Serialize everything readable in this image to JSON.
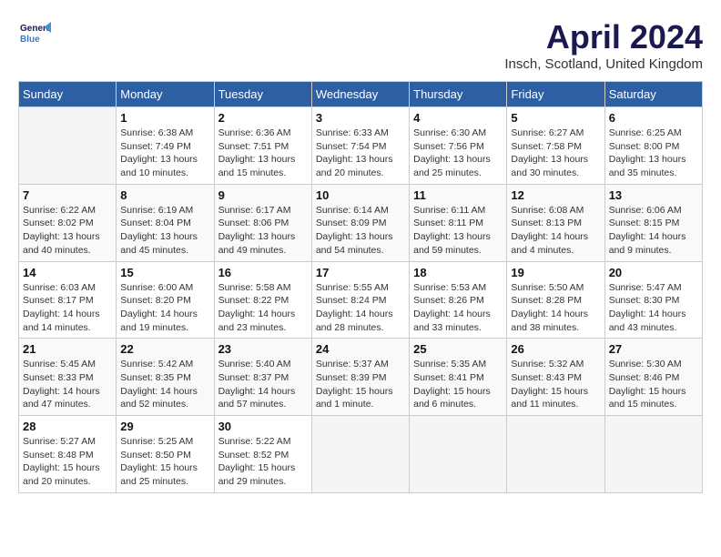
{
  "header": {
    "logo_line1": "General",
    "logo_line2": "Blue",
    "month_title": "April 2024",
    "location": "Insch, Scotland, United Kingdom"
  },
  "weekdays": [
    "Sunday",
    "Monday",
    "Tuesday",
    "Wednesday",
    "Thursday",
    "Friday",
    "Saturday"
  ],
  "weeks": [
    [
      {
        "day": "",
        "info": ""
      },
      {
        "day": "1",
        "info": "Sunrise: 6:38 AM\nSunset: 7:49 PM\nDaylight: 13 hours\nand 10 minutes."
      },
      {
        "day": "2",
        "info": "Sunrise: 6:36 AM\nSunset: 7:51 PM\nDaylight: 13 hours\nand 15 minutes."
      },
      {
        "day": "3",
        "info": "Sunrise: 6:33 AM\nSunset: 7:54 PM\nDaylight: 13 hours\nand 20 minutes."
      },
      {
        "day": "4",
        "info": "Sunrise: 6:30 AM\nSunset: 7:56 PM\nDaylight: 13 hours\nand 25 minutes."
      },
      {
        "day": "5",
        "info": "Sunrise: 6:27 AM\nSunset: 7:58 PM\nDaylight: 13 hours\nand 30 minutes."
      },
      {
        "day": "6",
        "info": "Sunrise: 6:25 AM\nSunset: 8:00 PM\nDaylight: 13 hours\nand 35 minutes."
      }
    ],
    [
      {
        "day": "7",
        "info": "Sunrise: 6:22 AM\nSunset: 8:02 PM\nDaylight: 13 hours\nand 40 minutes."
      },
      {
        "day": "8",
        "info": "Sunrise: 6:19 AM\nSunset: 8:04 PM\nDaylight: 13 hours\nand 45 minutes."
      },
      {
        "day": "9",
        "info": "Sunrise: 6:17 AM\nSunset: 8:06 PM\nDaylight: 13 hours\nand 49 minutes."
      },
      {
        "day": "10",
        "info": "Sunrise: 6:14 AM\nSunset: 8:09 PM\nDaylight: 13 hours\nand 54 minutes."
      },
      {
        "day": "11",
        "info": "Sunrise: 6:11 AM\nSunset: 8:11 PM\nDaylight: 13 hours\nand 59 minutes."
      },
      {
        "day": "12",
        "info": "Sunrise: 6:08 AM\nSunset: 8:13 PM\nDaylight: 14 hours\nand 4 minutes."
      },
      {
        "day": "13",
        "info": "Sunrise: 6:06 AM\nSunset: 8:15 PM\nDaylight: 14 hours\nand 9 minutes."
      }
    ],
    [
      {
        "day": "14",
        "info": "Sunrise: 6:03 AM\nSunset: 8:17 PM\nDaylight: 14 hours\nand 14 minutes."
      },
      {
        "day": "15",
        "info": "Sunrise: 6:00 AM\nSunset: 8:20 PM\nDaylight: 14 hours\nand 19 minutes."
      },
      {
        "day": "16",
        "info": "Sunrise: 5:58 AM\nSunset: 8:22 PM\nDaylight: 14 hours\nand 23 minutes."
      },
      {
        "day": "17",
        "info": "Sunrise: 5:55 AM\nSunset: 8:24 PM\nDaylight: 14 hours\nand 28 minutes."
      },
      {
        "day": "18",
        "info": "Sunrise: 5:53 AM\nSunset: 8:26 PM\nDaylight: 14 hours\nand 33 minutes."
      },
      {
        "day": "19",
        "info": "Sunrise: 5:50 AM\nSunset: 8:28 PM\nDaylight: 14 hours\nand 38 minutes."
      },
      {
        "day": "20",
        "info": "Sunrise: 5:47 AM\nSunset: 8:30 PM\nDaylight: 14 hours\nand 43 minutes."
      }
    ],
    [
      {
        "day": "21",
        "info": "Sunrise: 5:45 AM\nSunset: 8:33 PM\nDaylight: 14 hours\nand 47 minutes."
      },
      {
        "day": "22",
        "info": "Sunrise: 5:42 AM\nSunset: 8:35 PM\nDaylight: 14 hours\nand 52 minutes."
      },
      {
        "day": "23",
        "info": "Sunrise: 5:40 AM\nSunset: 8:37 PM\nDaylight: 14 hours\nand 57 minutes."
      },
      {
        "day": "24",
        "info": "Sunrise: 5:37 AM\nSunset: 8:39 PM\nDaylight: 15 hours\nand 1 minute."
      },
      {
        "day": "25",
        "info": "Sunrise: 5:35 AM\nSunset: 8:41 PM\nDaylight: 15 hours\nand 6 minutes."
      },
      {
        "day": "26",
        "info": "Sunrise: 5:32 AM\nSunset: 8:43 PM\nDaylight: 15 hours\nand 11 minutes."
      },
      {
        "day": "27",
        "info": "Sunrise: 5:30 AM\nSunset: 8:46 PM\nDaylight: 15 hours\nand 15 minutes."
      }
    ],
    [
      {
        "day": "28",
        "info": "Sunrise: 5:27 AM\nSunset: 8:48 PM\nDaylight: 15 hours\nand 20 minutes."
      },
      {
        "day": "29",
        "info": "Sunrise: 5:25 AM\nSunset: 8:50 PM\nDaylight: 15 hours\nand 25 minutes."
      },
      {
        "day": "30",
        "info": "Sunrise: 5:22 AM\nSunset: 8:52 PM\nDaylight: 15 hours\nand 29 minutes."
      },
      {
        "day": "",
        "info": ""
      },
      {
        "day": "",
        "info": ""
      },
      {
        "day": "",
        "info": ""
      },
      {
        "day": "",
        "info": ""
      }
    ]
  ]
}
